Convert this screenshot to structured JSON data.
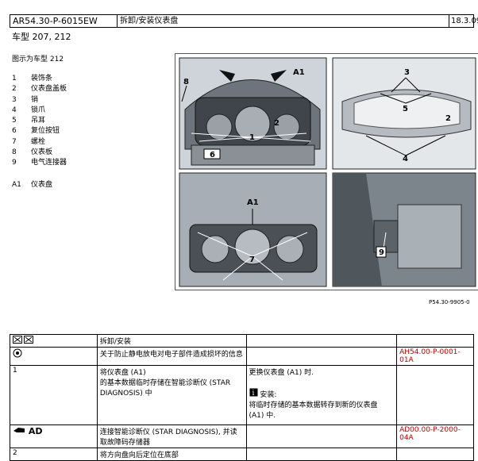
{
  "header": {
    "doc_id": "AR54.30-P-6015EW",
    "title": "拆卸/安装仪表盘",
    "date": "18.3.09"
  },
  "model_line": "车型  207, 212",
  "figure_caption": "图示为车型 212",
  "legend": [
    {
      "num": "1",
      "text": "装饰条"
    },
    {
      "num": "2",
      "text": "仪表盘盖板"
    },
    {
      "num": "3",
      "text": "销"
    },
    {
      "num": "4",
      "text": "锁爪"
    },
    {
      "num": "5",
      "text": "吊耳"
    },
    {
      "num": "6",
      "text": "复位按钮"
    },
    {
      "num": "7",
      "text": "螺栓"
    },
    {
      "num": "8",
      "text": "仪表板"
    },
    {
      "num": "9",
      "text": "电气连接器"
    }
  ],
  "legend_a1": {
    "num": "A1",
    "text": "仪表盘"
  },
  "figure_ref": "P54.30-9905-0",
  "callouts": {
    "p1": [
      "8",
      "A1",
      "2",
      "1",
      "6"
    ],
    "p2": [
      "3",
      "5",
      "2",
      "4"
    ],
    "p3": [
      "A1",
      "7"
    ],
    "p4": [
      "9"
    ]
  },
  "table": {
    "head_icon": "remove-install-icon",
    "head_label": "拆卸/安装",
    "rows": [
      {
        "col1": "",
        "col1_icon": "warning-circle-icon",
        "col2": "关于防止静电放电对电子部件造成损坏的信息",
        "col3": "",
        "ref": "AH54.00-P-0001-01A"
      },
      {
        "col1": "1",
        "col2_a": "将仪表盘 (A1)",
        "col2_b": "的基本数据临时存储在智能诊断仪 (STAR DIAGNOSIS) 中",
        "col3_a": "更换仪表盘 (A1) 时.",
        "col3_b_label": "安装:",
        "col3_b": "将临时存储的基本数据转存到新的仪表盘 (A1) 中.",
        "ref": ""
      },
      {
        "col1": "AD",
        "col1_icon": "diagnosis-hand-icon",
        "col2": "连接智能诊断仪 (STAR DIAGNOSIS), 并读取故障码存储器",
        "col3": "",
        "ref": "AD00.00-P-2000-04A"
      },
      {
        "col1": "2",
        "col2": "将方向盘向后定位在底部",
        "col3": "",
        "ref": ""
      }
    ]
  }
}
